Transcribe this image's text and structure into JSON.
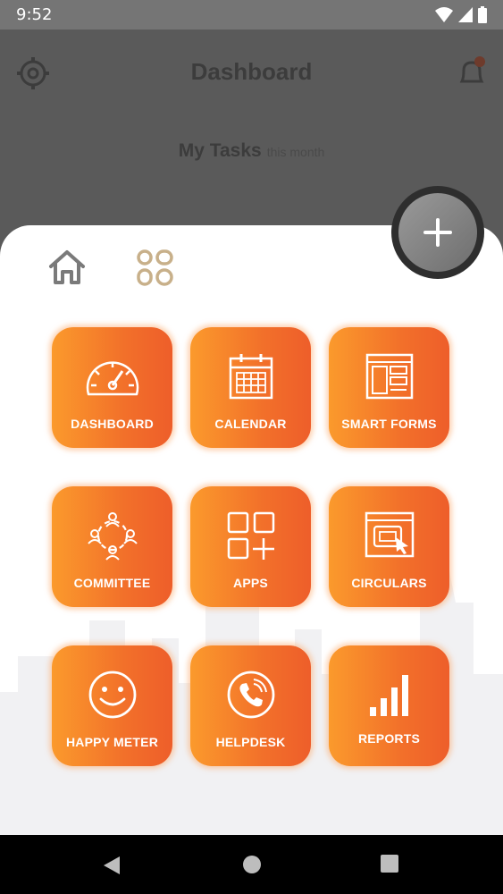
{
  "status_bar": {
    "time": "9:52"
  },
  "background_screen": {
    "title": "Dashboard",
    "tasks_heading": "My Tasks",
    "tasks_sub": "this month"
  },
  "fab": {
    "icon": "plus-icon"
  },
  "tabs": [
    {
      "icon": "home-icon"
    },
    {
      "icon": "apps-grid-icon",
      "active_color": "#c8b08a"
    }
  ],
  "menu": {
    "accent_start": "#fb9a2c",
    "accent_end": "#ee5e2a",
    "items": [
      {
        "label": "DASHBOARD",
        "icon": "speedometer-icon"
      },
      {
        "label": "CALENDAR",
        "icon": "calendar-icon"
      },
      {
        "label": "SMART FORMS",
        "icon": "form-icon"
      },
      {
        "label": "COMMITTEE",
        "icon": "committee-icon"
      },
      {
        "label": "APPS",
        "icon": "apps-icon"
      },
      {
        "label": "CIRCULARS",
        "icon": "circular-icon"
      },
      {
        "label": "HAPPY METER",
        "icon": "smiley-icon"
      },
      {
        "label": "HELPDESK",
        "icon": "phone-icon"
      },
      {
        "label": "REPORTS",
        "icon": "bar-chart-icon"
      }
    ]
  }
}
